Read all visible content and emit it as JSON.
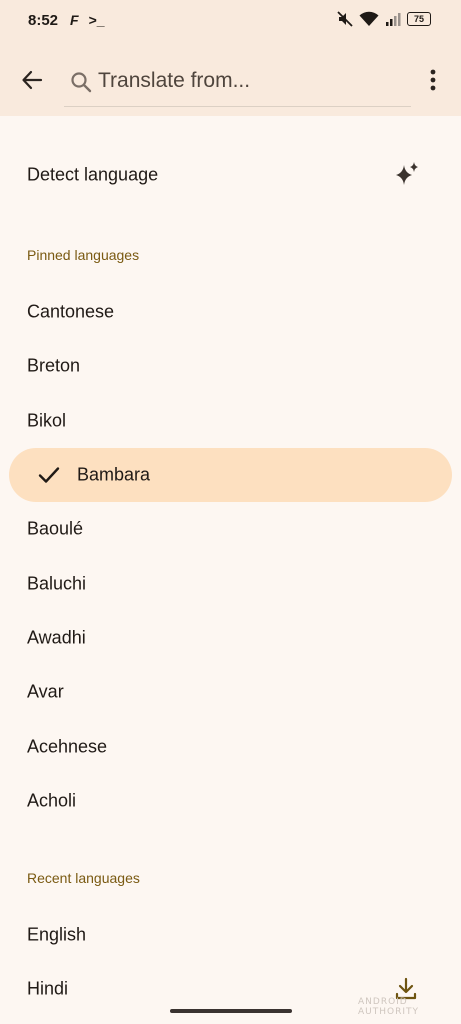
{
  "status_bar": {
    "time": "8:52",
    "app_icons": [
      "F",
      ">_"
    ],
    "battery": "75",
    "icons": [
      "mute-icon",
      "wifi-icon",
      "signal-icon",
      "battery-icon"
    ]
  },
  "header": {
    "back_icon": "arrow-back-icon",
    "search_placeholder": "Translate from...",
    "more_icon": "more-vert-icon"
  },
  "detect": {
    "label": "Detect language",
    "icon": "sparkle-icon"
  },
  "pinned": {
    "title": "Pinned languages",
    "items": [
      "Cantonese",
      "Breton",
      "Bikol",
      "Bambara",
      "Baoulé",
      "Baluchi",
      "Awadhi",
      "Avar",
      "Acehnese",
      "Acholi"
    ],
    "selected": "Bambara"
  },
  "recent": {
    "title": "Recent languages",
    "items": [
      "English",
      "Hindi"
    ]
  },
  "watermark": "ANDROID AUTHORITY",
  "colors": {
    "header_bg": "#f9eadd",
    "page_bg": "#fdf7f2",
    "selected_bg": "#fde0c0",
    "section_label": "#7a5a12"
  }
}
